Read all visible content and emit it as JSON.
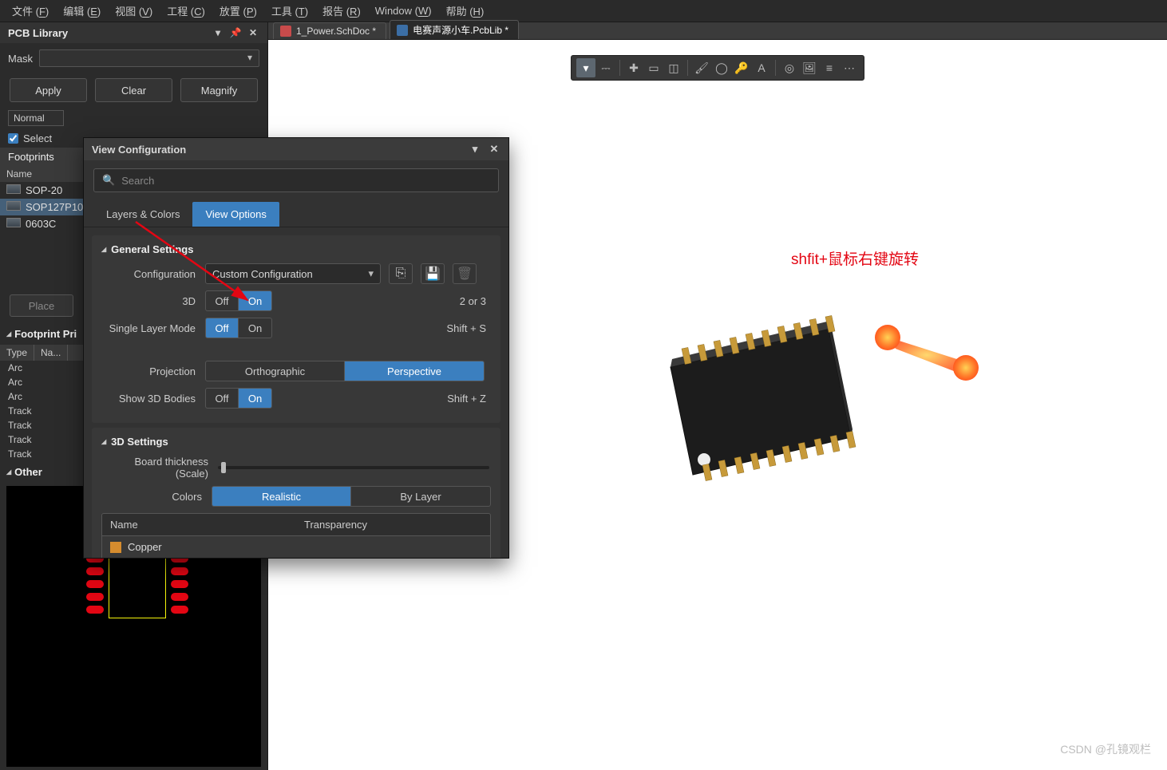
{
  "menubar": [
    {
      "label": "文件 (F)",
      "u": "F"
    },
    {
      "label": "编辑 (E)",
      "u": "E"
    },
    {
      "label": "视图 (V)",
      "u": "V"
    },
    {
      "label": "工程 (C)",
      "u": "C"
    },
    {
      "label": "放置 (P)",
      "u": "P"
    },
    {
      "label": "工具 (T)",
      "u": "T"
    },
    {
      "label": "报告 (R)",
      "u": "R"
    },
    {
      "label": "Window (W)",
      "u": "W"
    },
    {
      "label": "帮助 (H)",
      "u": "H"
    }
  ],
  "panel": {
    "title": "PCB Library",
    "mask_label": "Mask",
    "apply": "Apply",
    "clear": "Clear",
    "magnify": "Magnify",
    "normal": "Normal",
    "select": "Select",
    "footprints": "Footprints",
    "name_header": "Name",
    "footprint_list": [
      {
        "name": "SOP-20",
        "selected": false
      },
      {
        "name": "SOP127P10",
        "selected": true
      },
      {
        "name": "0603C",
        "selected": false
      }
    ],
    "place": "Place",
    "fp_prim_header": "Footprint Pri",
    "prim_cols": {
      "type": "Type",
      "name": "Na..."
    },
    "prim_rows": [
      "Arc",
      "Arc",
      "Arc",
      "Track",
      "Track",
      "Track",
      "Track"
    ],
    "other_header": "Other"
  },
  "tabs": [
    {
      "label": "1_Power.SchDoc *",
      "kind": "sch",
      "active": false,
      "dirty": true
    },
    {
      "label": "电赛声源小车.PcbLib *",
      "kind": "pcb",
      "active": true,
      "dirty": true
    }
  ],
  "canvas": {
    "callout": "shfit+鼠标右键旋转",
    "watermark": "CSDN @孔镜观栏"
  },
  "viewconfig": {
    "title": "View Configuration",
    "search_placeholder": "Search",
    "tabs": {
      "layers": "Layers & Colors",
      "view": "View Options"
    },
    "general": {
      "head": "General Settings",
      "config": "Configuration",
      "config_value": "Custom Configuration",
      "threeD": "3D",
      "threeD_hint": "2 or 3",
      "single": "Single Layer Mode",
      "single_hint": "Shift + S",
      "projection": "Projection",
      "projection_vals": {
        "ortho": "Orthographic",
        "persp": "Perspective"
      },
      "show3d": "Show 3D Bodies",
      "show3d_hint": "Shift + Z",
      "off": "Off",
      "on": "On"
    },
    "threeD": {
      "head": "3D Settings",
      "scale": "Board thickness (Scale)",
      "colors": "Colors",
      "realistic": "Realistic",
      "bylayer": "By Layer",
      "tbl_name": "Name",
      "tbl_trans": "Transparency",
      "row_copper": "Copper"
    }
  }
}
